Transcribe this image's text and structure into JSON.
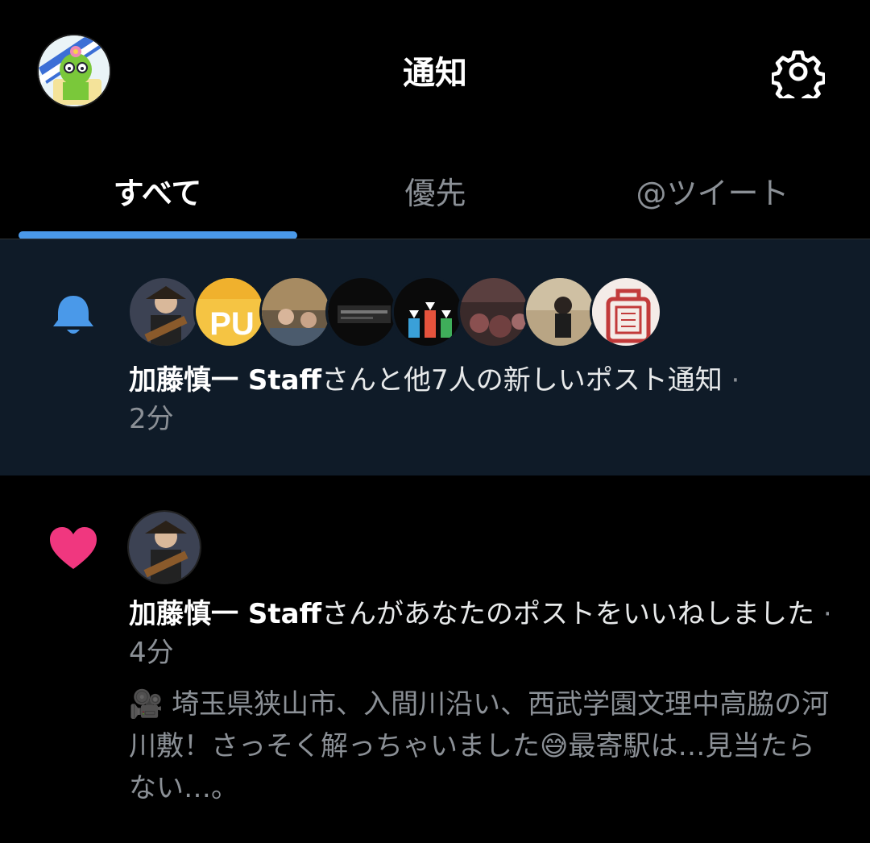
{
  "header": {
    "title": "通知",
    "profile_icon": "profile-avatar-icon",
    "settings_icon": "gear-icon"
  },
  "tabs": [
    {
      "label": "すべて",
      "active": true
    },
    {
      "label": "優先",
      "active": false
    },
    {
      "label": "@ツイート",
      "active": false
    }
  ],
  "notifications": [
    {
      "type": "new-posts",
      "icon": "bell-icon",
      "name": "加藤慎一 Staff",
      "text": "さんと他7人の新しいポスト通知",
      "sep": " · ",
      "time": "2分",
      "avatar_count": 8
    },
    {
      "type": "like",
      "icon": "heart-icon",
      "name": "加藤慎一 Staff",
      "text": "さんがあなたのポストをいいねしました",
      "sep": " · ",
      "time": "4分",
      "quote": "🎥 埼玉県狭山市、入間川沿い、西武学園文理中高脇の河川敷！さっそく解っちゃいました😅最寄駅は…見当たらない…。"
    }
  ],
  "colors": {
    "accent": "#4a99e9",
    "like": "#f0377f",
    "highlight_bg": "#0f1b28"
  }
}
